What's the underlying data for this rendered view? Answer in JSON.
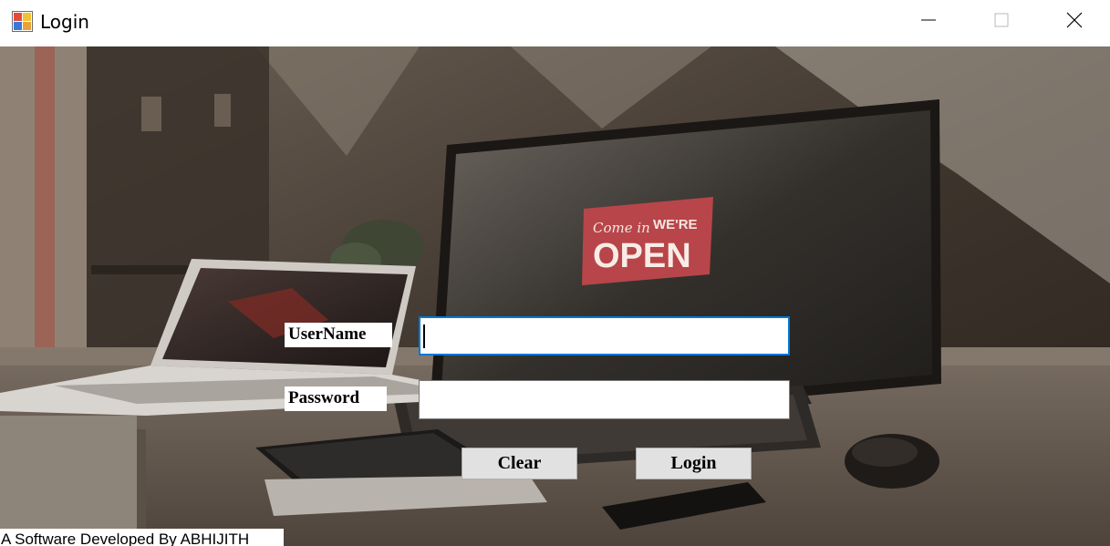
{
  "window": {
    "title": "Login",
    "icon": "app-form-icon",
    "controls": {
      "minimize_icon": "minimize-icon",
      "maximize_icon": "maximize-icon",
      "close_icon": "close-icon"
    }
  },
  "background": {
    "sign_script": "Come in",
    "sign_top": "WE'RE",
    "sign_main": "OPEN"
  },
  "form": {
    "username_label": "UserName",
    "username_value": "",
    "password_label": "Password",
    "password_value": "",
    "clear_label": "Clear",
    "login_label": "Login"
  },
  "footer": {
    "credit": "A Software Developed By ABHIJITH"
  },
  "colors": {
    "focus_border": "#0078d7",
    "button_face": "#e1e1e1",
    "sign_red": "#b8454a"
  }
}
